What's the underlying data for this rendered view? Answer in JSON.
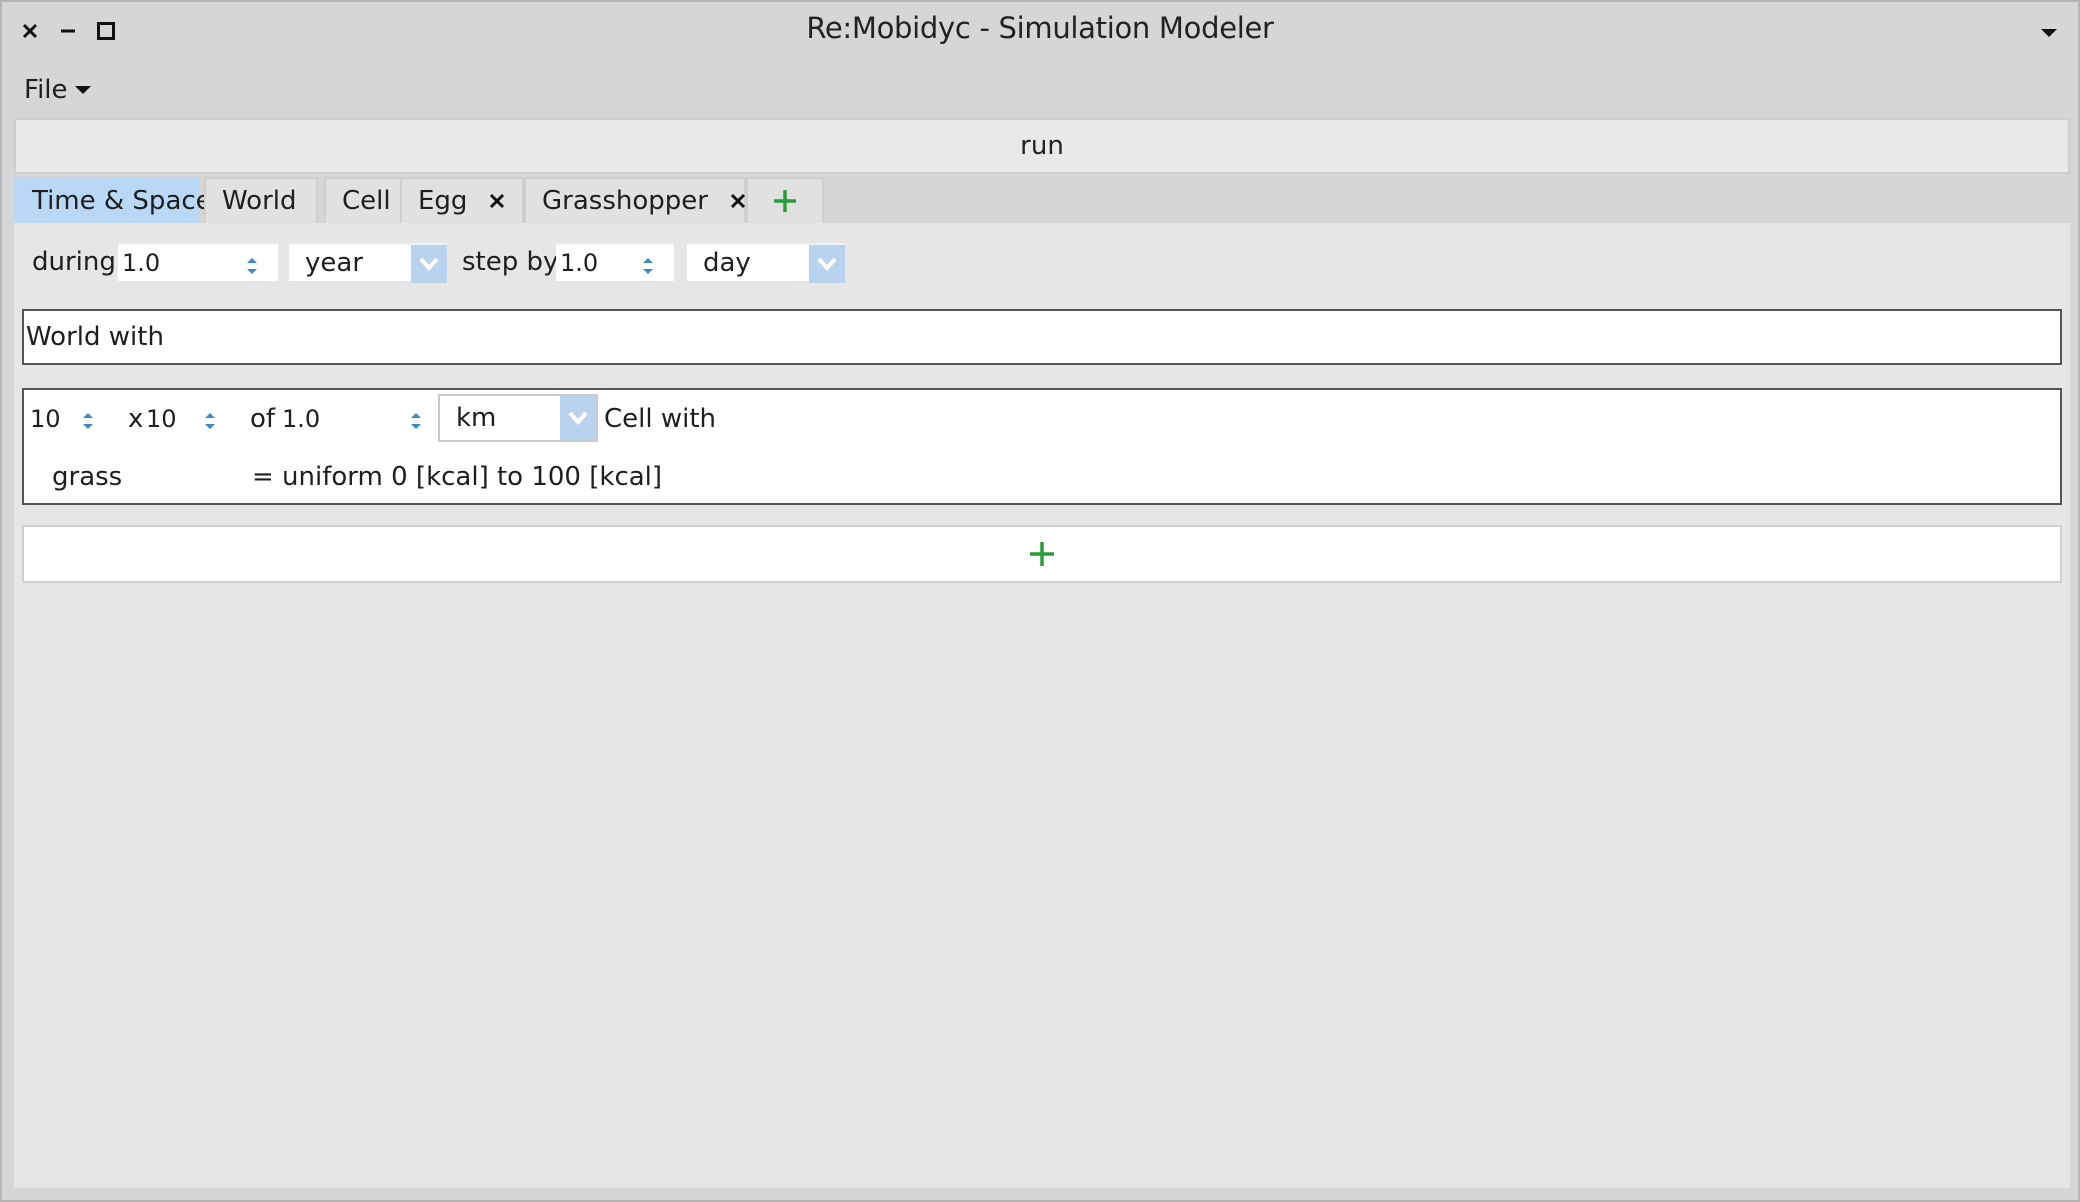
{
  "window": {
    "title": "Re:Mobidyc - Simulation Modeler"
  },
  "menubar": {
    "file_label": "File"
  },
  "toolbar": {
    "run_label": "run"
  },
  "tabs": [
    {
      "label": "Time & Space",
      "active": true,
      "closable": false
    },
    {
      "label": "World",
      "active": false,
      "closable": false
    },
    {
      "label": "Cell",
      "active": false,
      "closable": false
    },
    {
      "label": "Egg",
      "active": false,
      "closable": true
    },
    {
      "label": "Grasshopper",
      "active": false,
      "closable": true
    }
  ],
  "time": {
    "during_label": "during",
    "during_value": "1.0",
    "during_unit": "year",
    "step_label": "step by",
    "step_value": "1.0",
    "step_unit": "day"
  },
  "world": {
    "label": "World with"
  },
  "cell": {
    "cols": "10",
    "x_label": "x",
    "rows": "10",
    "of_label": "of",
    "size": "1.0",
    "unit": "km",
    "cell_with_label": "Cell with",
    "attribute_name": "grass",
    "attribute_expr": "= uniform 0 [kcal] to 100 [kcal]"
  },
  "colors": {
    "accent": "#b9d8f6",
    "add_green": "#2a9d3a",
    "arrow_blue": "#3b8ac4"
  }
}
